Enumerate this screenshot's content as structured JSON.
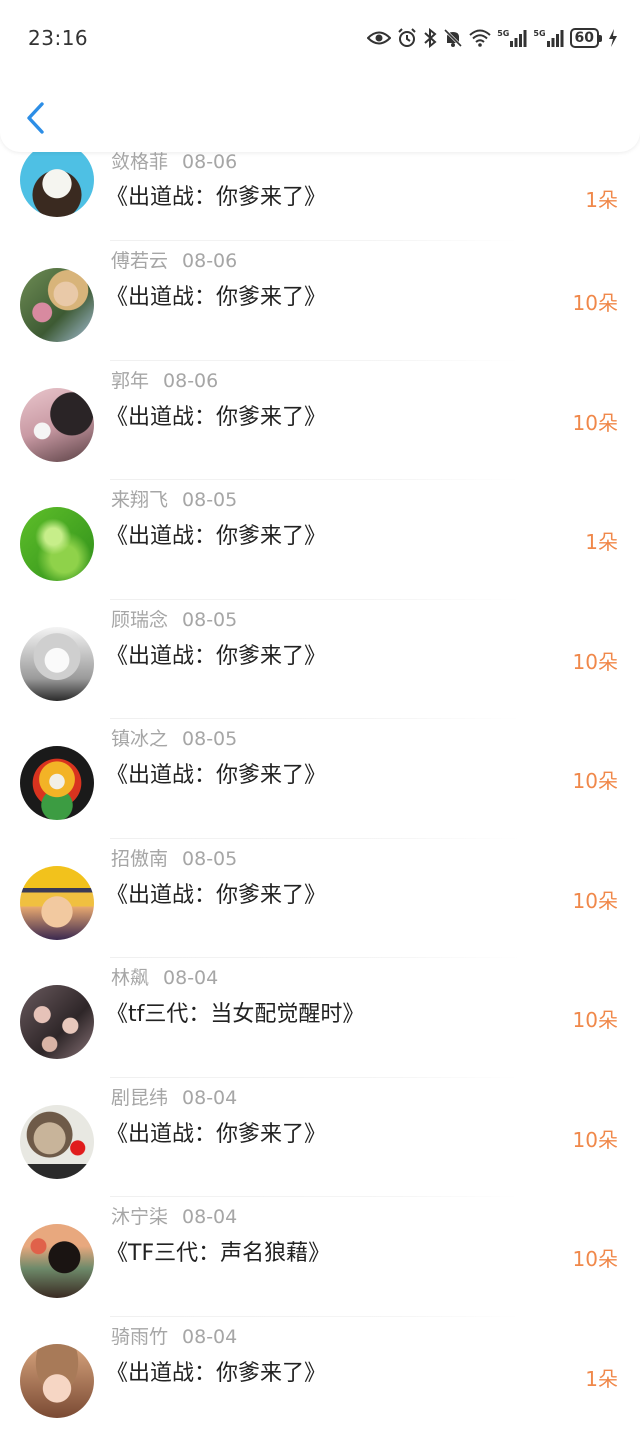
{
  "status_bar": {
    "time": "23:16",
    "battery": "60",
    "signal_1": "5G",
    "signal_2": "5G"
  },
  "colors": {
    "accent": "#2d8ee6",
    "count": "#f0884a"
  },
  "entries": [
    {
      "name": "敛格菲",
      "date": "08-06",
      "title": "《出道战：你爹来了》",
      "count": "1朵"
    },
    {
      "name": "傅若云",
      "date": "08-06",
      "title": "《出道战：你爹来了》",
      "count": "10朵"
    },
    {
      "name": "郭年",
      "date": "08-06",
      "title": "《出道战：你爹来了》",
      "count": "10朵"
    },
    {
      "name": "来翔飞",
      "date": "08-05",
      "title": "《出道战：你爹来了》",
      "count": "1朵"
    },
    {
      "name": "顾瑞念",
      "date": "08-05",
      "title": "《出道战：你爹来了》",
      "count": "10朵"
    },
    {
      "name": "镇冰之",
      "date": "08-05",
      "title": "《出道战：你爹来了》",
      "count": "10朵"
    },
    {
      "name": "招傲南",
      "date": "08-05",
      "title": "《出道战：你爹来了》",
      "count": "10朵"
    },
    {
      "name": "林飙",
      "date": "08-04",
      "title": "《tf三代：当女配觉醒时》",
      "count": "10朵"
    },
    {
      "name": "剧昆纬",
      "date": "08-04",
      "title": "《出道战：你爹来了》",
      "count": "10朵"
    },
    {
      "name": "沐宁柒",
      "date": "08-04",
      "title": "《TF三代：声名狼藉》",
      "count": "10朵"
    },
    {
      "name": "骑雨竹",
      "date": "08-04",
      "title": "《出道战：你爹来了》",
      "count": "1朵"
    }
  ]
}
